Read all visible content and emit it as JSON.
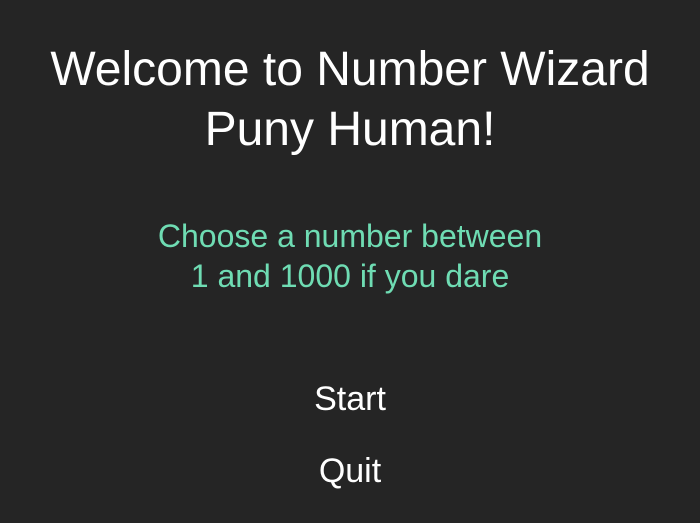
{
  "welcome": {
    "line1": "Welcome to Number Wizard",
    "line2": "Puny Human!"
  },
  "instructions": {
    "line1": "Choose a number between",
    "line2": "1 and 1000 if you dare"
  },
  "menu": {
    "start_label": "Start",
    "quit_label": "Quit"
  },
  "colors": {
    "background": "#252525",
    "title_text": "#ffffff",
    "subtitle_text": "#6fdcb3",
    "button_text": "#ffffff"
  }
}
